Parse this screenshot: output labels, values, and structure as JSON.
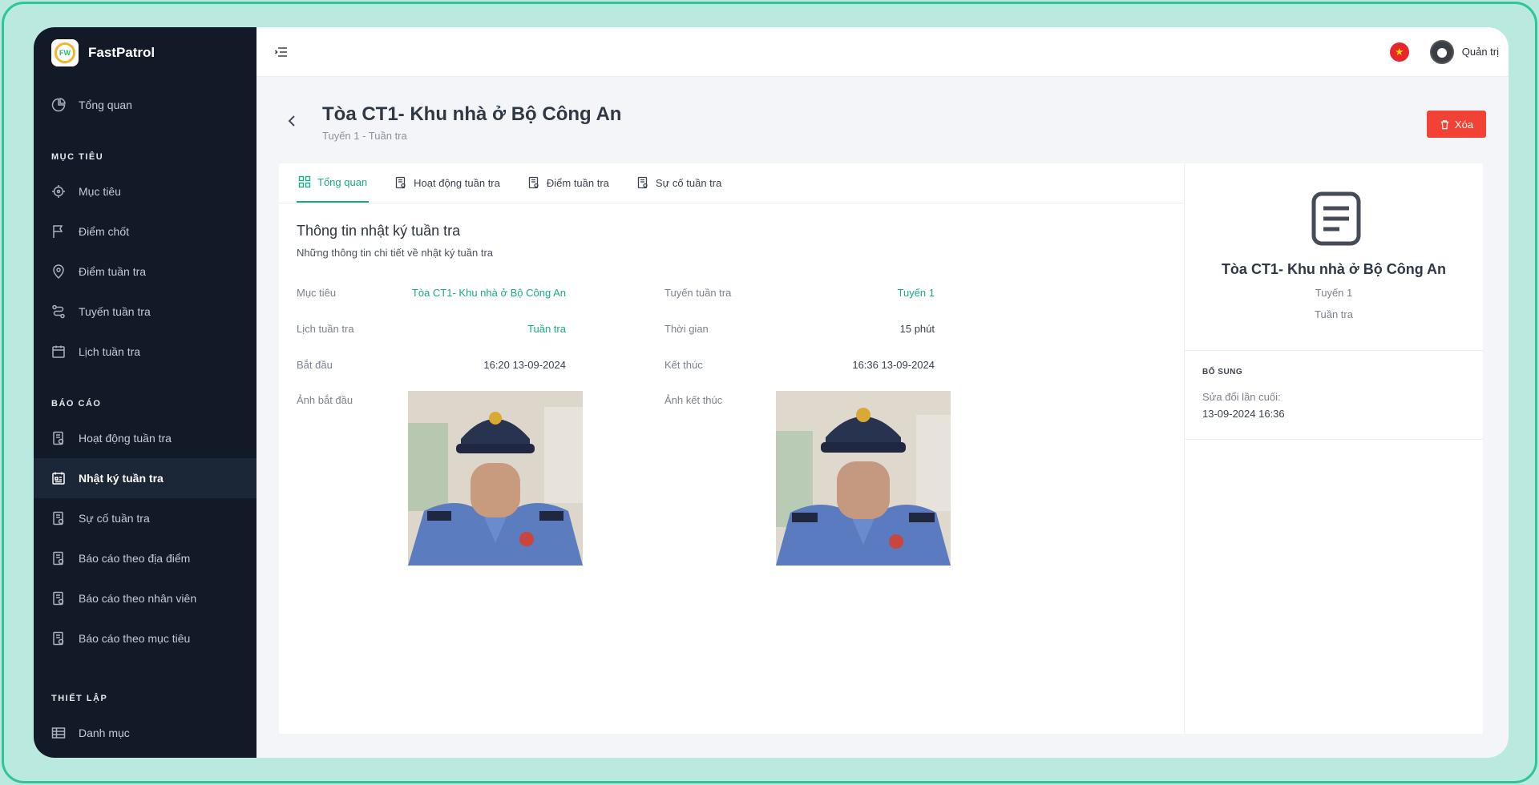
{
  "brand": {
    "name": "FastPatrol",
    "logo_text": "FW"
  },
  "sidebar": {
    "top_item": {
      "label": "Tổng quan"
    },
    "sections": [
      {
        "title": "MỤC TIÊU",
        "items": [
          {
            "label": "Mục tiêu",
            "icon": "target-icon"
          },
          {
            "label": "Điểm chốt",
            "icon": "flag-icon"
          },
          {
            "label": "Điểm tuần tra",
            "icon": "map-pin-icon"
          },
          {
            "label": "Tuyến tuần tra",
            "icon": "route-icon"
          },
          {
            "label": "Lịch tuần tra",
            "icon": "calendar-icon"
          }
        ]
      },
      {
        "title": "BÁO CÁO",
        "items": [
          {
            "label": "Hoạt động tuần tra",
            "icon": "report-icon"
          },
          {
            "label": "Nhật ký tuần tra",
            "icon": "journal-icon",
            "active": true
          },
          {
            "label": "Sự cố tuần tra",
            "icon": "report-icon"
          },
          {
            "label": "Báo cáo theo địa điểm",
            "icon": "report-icon"
          },
          {
            "label": "Báo cáo theo nhân viên",
            "icon": "report-icon"
          },
          {
            "label": "Báo cáo theo mục tiêu",
            "icon": "report-icon"
          }
        ]
      },
      {
        "title": "THIẾT LẬP",
        "items": [
          {
            "label": "Danh mục",
            "icon": "table-icon"
          }
        ]
      }
    ]
  },
  "topbar": {
    "username": "Quản trị"
  },
  "header": {
    "title": "Tòa CT1- Khu nhà ở Bộ Công An",
    "subtitle": "Tuyến 1 - Tuần tra",
    "delete_label": "Xóa"
  },
  "tabs": [
    {
      "label": "Tổng quan",
      "active": true
    },
    {
      "label": "Hoạt động tuần tra"
    },
    {
      "label": "Điểm tuần tra"
    },
    {
      "label": "Sự cố tuần tra"
    }
  ],
  "details": {
    "heading": "Thông tin nhật ký tuần tra",
    "description": "Những thông tin chi tiết về nhật ký tuần tra",
    "target_label": "Mục tiêu",
    "target_value": "Tòa CT1- Khu nhà ở Bộ Công An",
    "route_label": "Tuyến tuần tra",
    "route_value": "Tuyến 1",
    "schedule_label": "Lịch tuần tra",
    "schedule_value": "Tuần tra",
    "duration_label": "Thời gian",
    "duration_value": "15 phút",
    "start_label": "Bắt đầu",
    "start_value": "16:20 13-09-2024",
    "end_label": "Kết thúc",
    "end_value": "16:36 13-09-2024",
    "start_photo_label": "Ảnh bắt đầu",
    "end_photo_label": "Ảnh kết thúc"
  },
  "summary": {
    "title": "Tòa CT1- Khu nhà ở Bộ Công An",
    "line1": "Tuyến 1",
    "line2": "Tuần tra",
    "section_title": "BỔ SUNG",
    "modified_label": "Sửa đổi lần cuối:",
    "modified_value": "13-09-2024 16:36"
  },
  "colors": {
    "accent": "#1aa98a",
    "danger": "#f24235",
    "sidebar": "#111a26"
  }
}
